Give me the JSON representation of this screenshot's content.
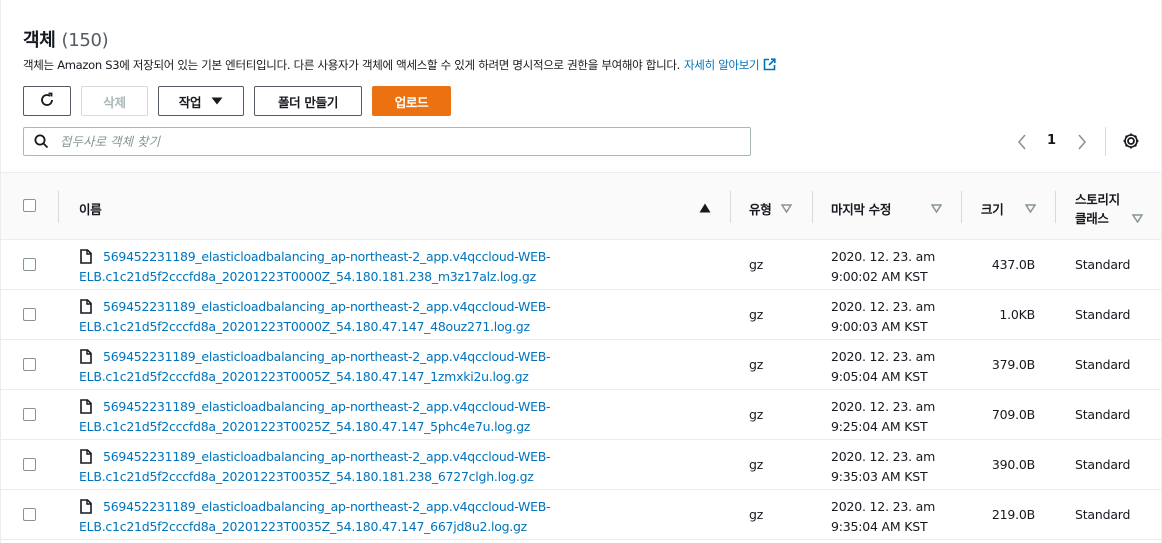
{
  "header": {
    "title": "객체",
    "count": "(150)",
    "description": "객체는 Amazon S3에 저장되어 있는 기본 엔터티입니다. 다른 사용자가 객체에 액세스할 수 있게 하려면 명시적으로 권한을 부여해야 합니다.",
    "learn_more": "자세히 알아보기"
  },
  "toolbar": {
    "refresh_icon": "refresh-icon",
    "delete_label": "삭제",
    "actions_label": "작업",
    "create_folder_label": "폴더 만들기",
    "upload_label": "업로드"
  },
  "search": {
    "placeholder": "접두사로 객체 찾기",
    "value": ""
  },
  "pagination": {
    "current_page": "1"
  },
  "colors": {
    "link": "#0073bb",
    "primary": "#ec7211",
    "border": "#eaeded",
    "header_bg": "#fafafa"
  },
  "table": {
    "columns": {
      "name": "이름",
      "type": "유형",
      "modified": "마지막 수정",
      "size": "크기",
      "storage_class_line1": "스토리지",
      "storage_class_line2": "클래스"
    },
    "rows": [
      {
        "name_line1": "569452231189_elasticloadbalancing_ap-northeast-2_app.v4qccloud-WEB-",
        "name_line2": "ELB.c1c21d5f2cccfd8a_20201223T0000Z_54.180.181.238_m3z17alz.log.gz",
        "type": "gz",
        "modified_line1": "2020. 12. 23. am",
        "modified_line2": "9:00:02 AM KST",
        "size": "437.0B",
        "storage_class": "Standard"
      },
      {
        "name_line1": "569452231189_elasticloadbalancing_ap-northeast-2_app.v4qccloud-WEB-",
        "name_line2": "ELB.c1c21d5f2cccfd8a_20201223T0000Z_54.180.47.147_48ouz271.log.gz",
        "type": "gz",
        "modified_line1": "2020. 12. 23. am",
        "modified_line2": "9:00:03 AM KST",
        "size": "1.0KB",
        "storage_class": "Standard"
      },
      {
        "name_line1": "569452231189_elasticloadbalancing_ap-northeast-2_app.v4qccloud-WEB-",
        "name_line2": "ELB.c1c21d5f2cccfd8a_20201223T0005Z_54.180.47.147_1zmxki2u.log.gz",
        "type": "gz",
        "modified_line1": "2020. 12. 23. am",
        "modified_line2": "9:05:04 AM KST",
        "size": "379.0B",
        "storage_class": "Standard"
      },
      {
        "name_line1": "569452231189_elasticloadbalancing_ap-northeast-2_app.v4qccloud-WEB-",
        "name_line2": "ELB.c1c21d5f2cccfd8a_20201223T0025Z_54.180.47.147_5phc4e7u.log.gz",
        "type": "gz",
        "modified_line1": "2020. 12. 23. am",
        "modified_line2": "9:25:04 AM KST",
        "size": "709.0B",
        "storage_class": "Standard"
      },
      {
        "name_line1": "569452231189_elasticloadbalancing_ap-northeast-2_app.v4qccloud-WEB-",
        "name_line2": "ELB.c1c21d5f2cccfd8a_20201223T0035Z_54.180.181.238_6727clgh.log.gz",
        "type": "gz",
        "modified_line1": "2020. 12. 23. am",
        "modified_line2": "9:35:03 AM KST",
        "size": "390.0B",
        "storage_class": "Standard"
      },
      {
        "name_line1": "569452231189_elasticloadbalancing_ap-northeast-2_app.v4qccloud-WEB-",
        "name_line2": "ELB.c1c21d5f2cccfd8a_20201223T0035Z_54.180.47.147_667jd8u2.log.gz",
        "type": "gz",
        "modified_line1": "2020. 12. 23. am",
        "modified_line2": "9:35:04 AM KST",
        "size": "219.0B",
        "storage_class": "Standard"
      }
    ]
  }
}
